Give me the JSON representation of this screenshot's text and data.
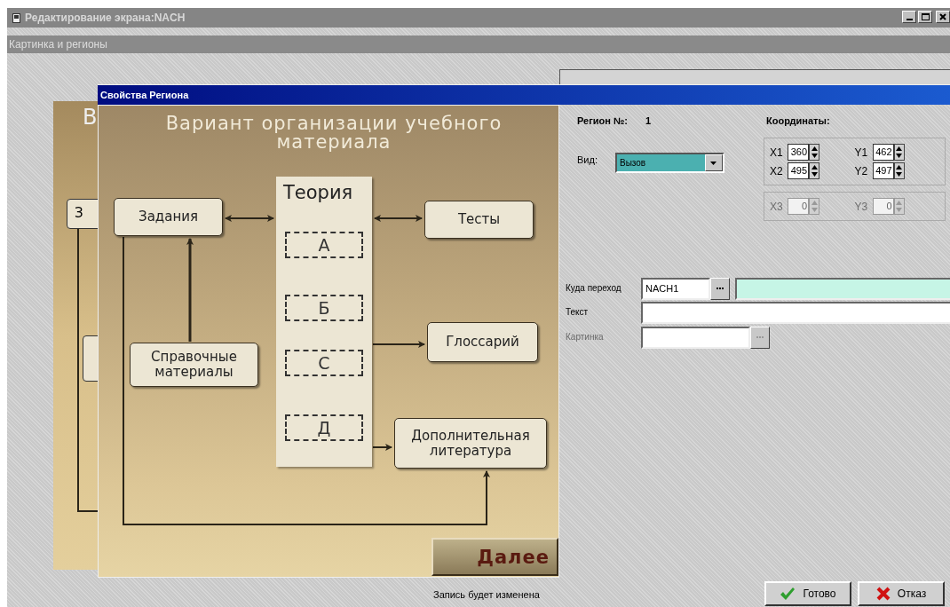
{
  "window": {
    "title": "Редактирование экрана:NACH"
  },
  "caption_bar": "Картинка и регионы",
  "background_picture": {
    "fragments": [
      "В",
      "З"
    ]
  },
  "dialog": {
    "title": "Свойства Региона",
    "picture": {
      "title": "Вариант организации учебного материала",
      "nodes": [
        {
          "kind": "box",
          "label": "Задания"
        },
        {
          "kind": "column",
          "label": "Теория",
          "sections": [
            "А",
            "Б",
            "С",
            "Д"
          ]
        },
        {
          "kind": "box",
          "label": "Тесты"
        },
        {
          "kind": "box",
          "label": "Справочные материалы"
        },
        {
          "kind": "box",
          "label": "Глоссарий"
        },
        {
          "kind": "box",
          "label": "Дополнительная литература"
        }
      ],
      "next_button": "Далее"
    },
    "region_label": "Регион №:",
    "region_number": "1",
    "coordinates_label": "Координаты:",
    "view": {
      "label": "Вид:",
      "value": "Вызов"
    },
    "coordinate_groups": [
      {
        "disabled": false,
        "fields": [
          {
            "label": "X1",
            "value": "360"
          },
          {
            "label": "Y1",
            "value": "462"
          },
          {
            "label": "X2",
            "value": "495"
          },
          {
            "label": "Y2",
            "value": "497"
          }
        ]
      },
      {
        "disabled": true,
        "fields": [
          {
            "label": "X3",
            "value": "0"
          },
          {
            "label": "Y3",
            "value": "0"
          }
        ]
      }
    ],
    "target": {
      "label": "Куда переход",
      "value": "NACH1"
    },
    "text": {
      "label": "Текст"
    },
    "picture_field": {
      "label": "Картинка",
      "disabled": true
    },
    "status": "Запись будет изменена",
    "buttons": [
      {
        "kind": "ok",
        "label": "Готово"
      },
      {
        "kind": "cancel",
        "label": "Отказ"
      }
    ]
  }
}
